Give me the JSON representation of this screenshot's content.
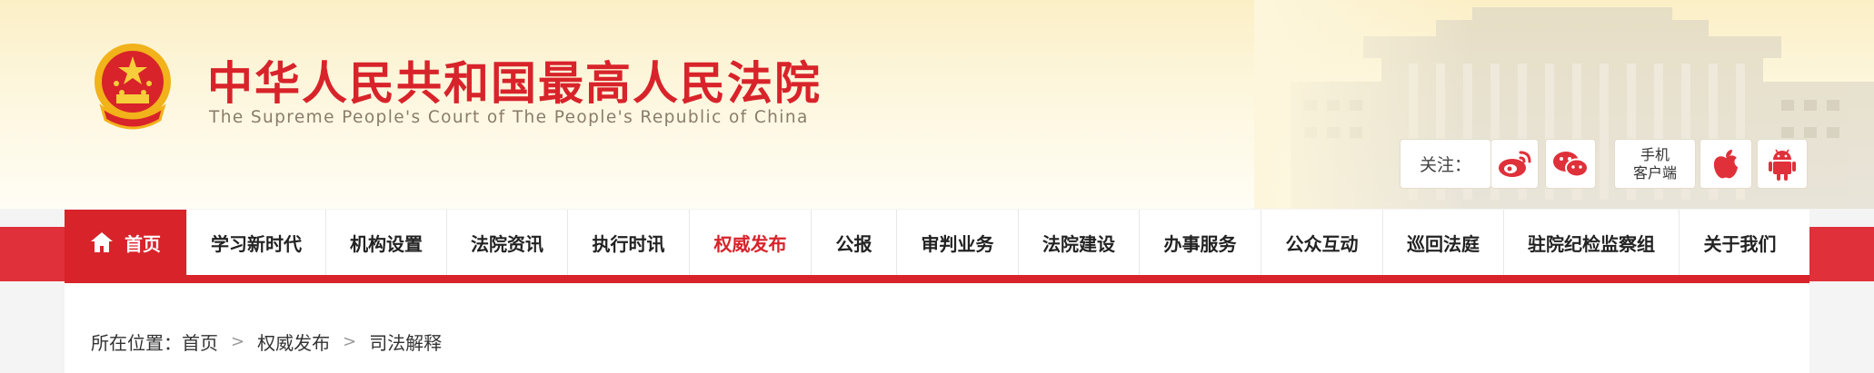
{
  "header": {
    "title": "中华人民共和国最高人民法院",
    "subtitle": "The Supreme People's Court of The People's Republic of China"
  },
  "follow": {
    "label": "关注：",
    "weibo_icon": "weibo-icon",
    "wechat_icon": "wechat-icon",
    "mobile_client_line1": "手机",
    "mobile_client_line2": "客户端",
    "apple_icon": "apple-icon",
    "android_icon": "android-icon"
  },
  "colors": {
    "brand_red": "#d8232a",
    "band_red": "#e0303a"
  },
  "nav": {
    "items": [
      {
        "label": "首页",
        "icon": "home-icon"
      },
      {
        "label": "学习新时代"
      },
      {
        "label": "机构设置"
      },
      {
        "label": "法院资讯"
      },
      {
        "label": "执行时讯"
      },
      {
        "label": "权威发布"
      },
      {
        "label": "公报"
      },
      {
        "label": "审判业务"
      },
      {
        "label": "法院建设"
      },
      {
        "label": "办事服务"
      },
      {
        "label": "公众互动"
      },
      {
        "label": "巡回法庭"
      },
      {
        "label": "驻院纪检监察组"
      },
      {
        "label": "关于我们"
      }
    ]
  },
  "breadcrumb": {
    "prefix": "所在位置：",
    "items": [
      "首页",
      "权威发布",
      "司法解释"
    ]
  }
}
